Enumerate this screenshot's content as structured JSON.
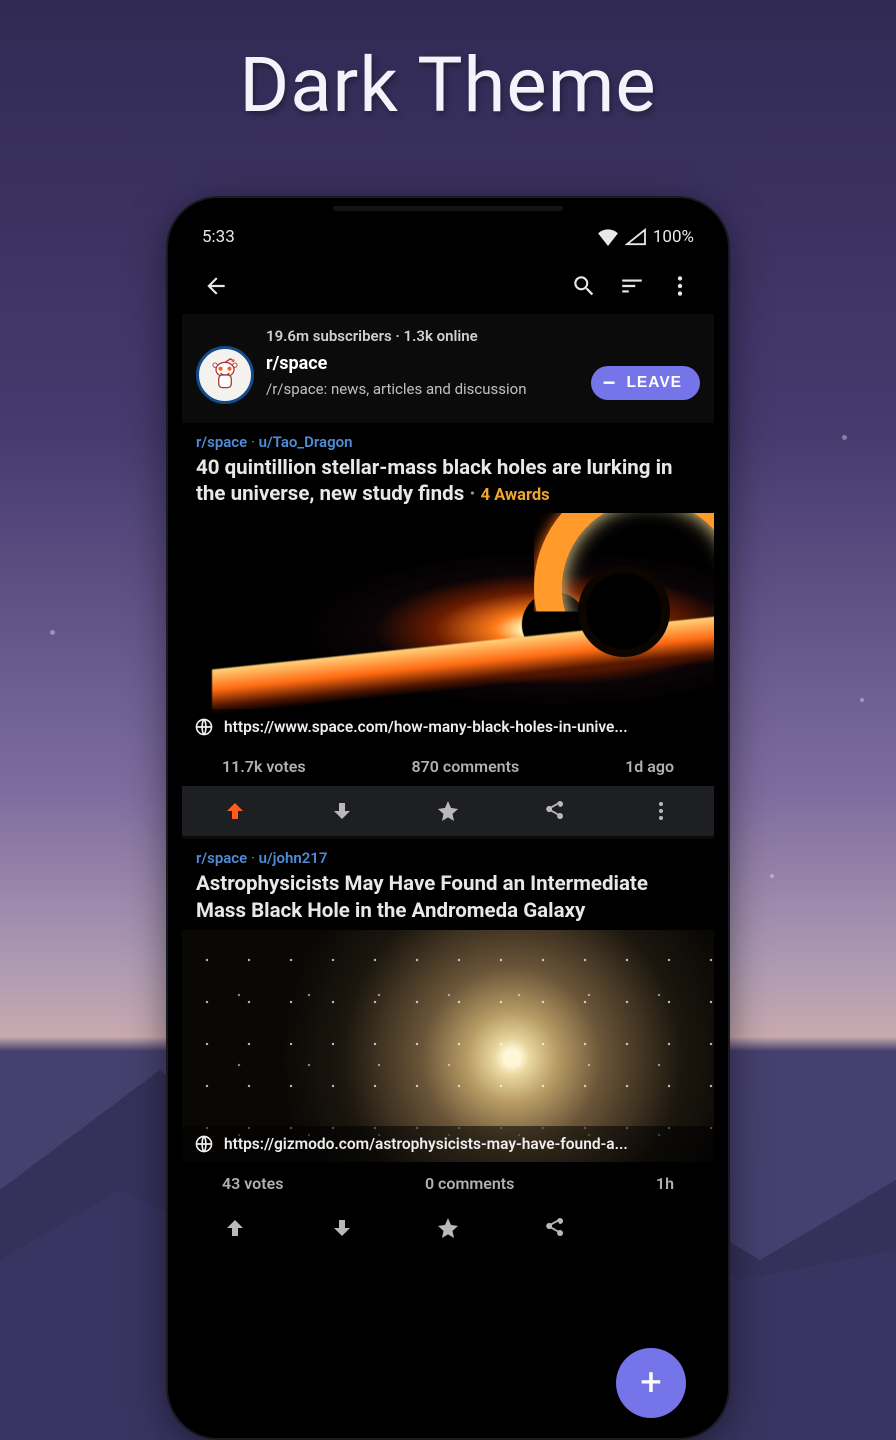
{
  "promo_title": "Dark Theme",
  "statusbar": {
    "time": "5:33",
    "battery": "100%"
  },
  "subreddit": {
    "meta": "19.6m subscribers · 1.3k online",
    "name": "r/space",
    "description": "/r/space: news, articles and discussion",
    "leave_label": "LEAVE"
  },
  "posts": [
    {
      "subreddit": "r/space",
      "author": "u/Tao_Dragon",
      "title": "40 quintillion stellar-mass black holes are lurking in the universe, new study finds",
      "awards": "4 Awards",
      "link": "https://www.space.com/how-many-black-holes-in-unive...",
      "votes": "11.7k votes",
      "comments": "870 comments",
      "age": "1d ago"
    },
    {
      "subreddit": "r/space",
      "author": "u/john217",
      "title": "Astrophysicists May Have Found an Intermediate Mass Black Hole in the Andromeda Galaxy",
      "awards": "",
      "link": "https://gizmodo.com/astrophysicists-may-have-found-a...",
      "votes": "43 votes",
      "comments": "0 comments",
      "age": "1h"
    }
  ],
  "fab_label": "+"
}
